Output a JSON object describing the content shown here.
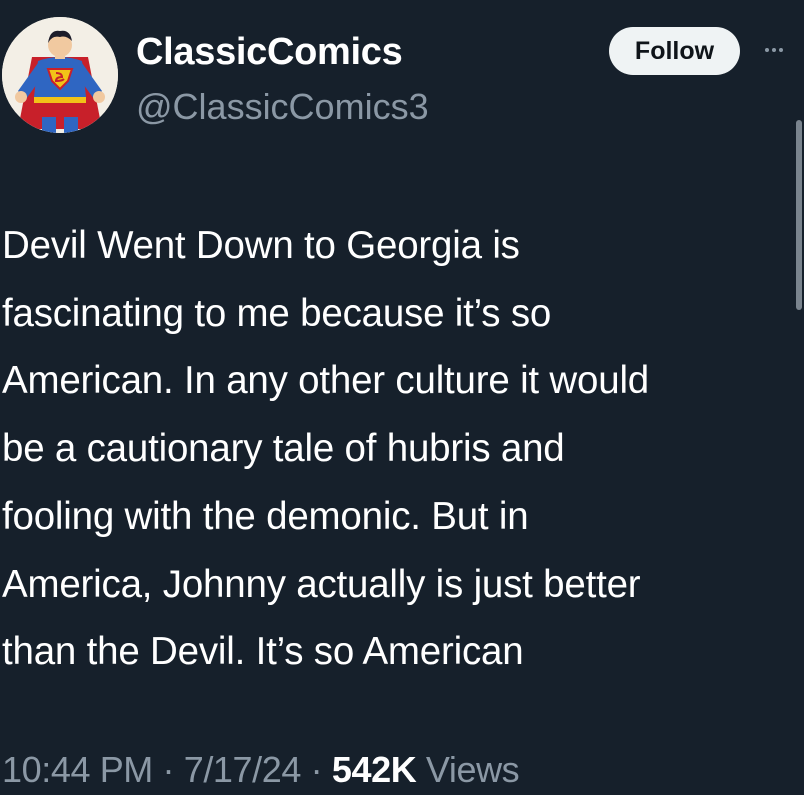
{
  "account": {
    "display_name": "ClassicComics",
    "handle": "@ClassicComics3",
    "avatar_icon": "superman-avatar-icon"
  },
  "actions": {
    "follow_label": "Follow",
    "more_icon": "more-horizontal-icon"
  },
  "tweet": {
    "lines": [
      "Devil Went Down to Georgia is",
      "fascinating to me because it’s so",
      "American. In any other culture it would",
      "be a cautionary tale of hubris and",
      "fooling with the demonic. But in",
      "America, Johnny actually is just better",
      "than the Devil. It’s so American"
    ]
  },
  "meta": {
    "time": "10:44 PM",
    "date": "7/17/24",
    "separator": "·",
    "views_count": "542K",
    "views_label": "Views"
  },
  "colors": {
    "background": "#16202b",
    "primary_text": "#ffffff",
    "secondary_text": "#8b98a5",
    "follow_button_bg": "#eff3f4"
  }
}
